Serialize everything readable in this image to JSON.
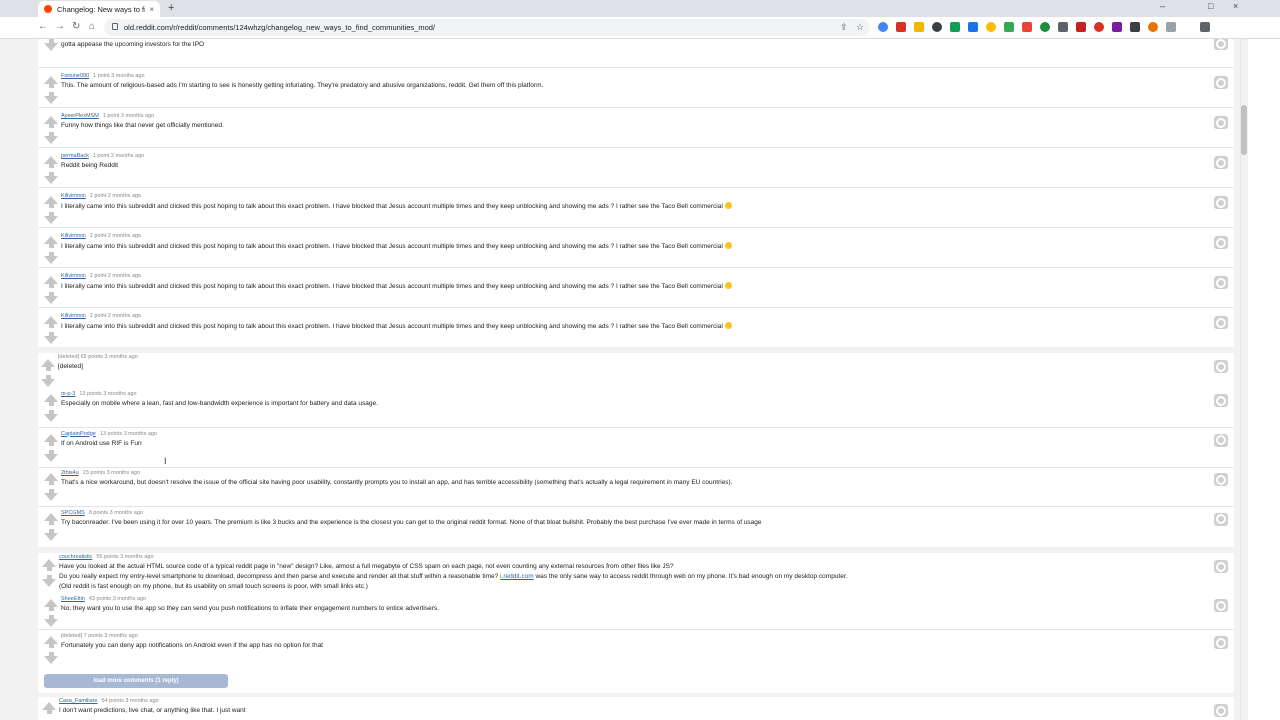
{
  "browser": {
    "tab_title": "Changelog: New ways to find c",
    "url": "old.reddit.com/r/reddit/comments/124whzg/changelog_new_ways_to_find_communities_mod/",
    "close_glyph": "×",
    "newtab_glyph": "+",
    "min_glyph": "–",
    "max_glyph": "□",
    "close_win_glyph": "×",
    "back_glyph": "←",
    "forward_glyph": "→",
    "reload_glyph": "↻",
    "home_glyph": "⌂",
    "share_glyph": "⇪",
    "star_glyph": "☆",
    "extensions_icon": "puzzle-icon",
    "extension_colors": [
      "#4285f4",
      "#d93025",
      "#f4b400",
      "#3c4043",
      "#0f9d58",
      "#1a73e8",
      "#fbbc04",
      "#34a853",
      "#ea4335",
      "#1e8e3e",
      "#5f6368",
      "#c5221f",
      "#d93025",
      "#7b1fa2",
      "#3c4043",
      "#e37400",
      "#9aa0a6"
    ]
  },
  "thread1": {
    "first_body": "gotta appease the upcoming investors for the IPO",
    "comments": [
      {
        "author": "Fortune090",
        "meta": "1 point 3 months ago",
        "body": "This. The amount of religious-based ads I'm starting to see is honestly getting infuriating. They're predatory and abusive organizations, reddit. Get them off this platform."
      },
      {
        "author": "AyeerPlexMSM",
        "meta": "1 point 3 months ago",
        "body": "Funny how things like that never get officially mentioned."
      },
      {
        "author": "permaBack",
        "meta": "1 point 2 months ago",
        "body": "Reddit being Reddit"
      },
      {
        "author": "Killvimmin",
        "meta": "1 point 2 months ago",
        "body": "I literally came into this subreddit and clicked this post hoping to talk about this exact problem. I have blocked that Jesus account multiple times and they keep unblocking and showing me ads ? I rather see the Taco Bell commercial"
      },
      {
        "author": "Killvimmin",
        "meta": "1 point 2 months ago",
        "body": "I literally came into this subreddit and clicked this post hoping to talk about this exact problem. I have blocked that Jesus account multiple times and they keep unblocking and showing me ads ? I rather see the Taco Bell commercial"
      },
      {
        "author": "Killvimmin",
        "meta": "1 point 2 months ago",
        "body": "I literally came into this subreddit and clicked this post hoping to talk about this exact problem. I have blocked that Jesus account multiple times and they keep unblocking and showing me ads ? I rather see the Taco Bell commercial"
      },
      {
        "author": "Killvimmin",
        "meta": "1 point 2 months ago",
        "body": "I literally came into this subreddit and clicked this post hoping to talk about this exact problem. I have blocked that Jesus account multiple times and they keep unblocking and showing me ads ? I rather see the Taco Bell commercial"
      }
    ]
  },
  "thread2": {
    "deleted_meta": "[deleted] 65 points 3 months ago",
    "deleted_body": "[deleted]",
    "comments": [
      {
        "author": "m-p-3",
        "meta": "13 points 3 months ago",
        "body": "Especially on mobile where a lean, fast and low-bandwidth experience is important for battery and data usage."
      },
      {
        "author": "CaptainPodge",
        "meta": "13 points 3 months ago",
        "body": "If on Android use RIF is Fun"
      },
      {
        "author": "2this4u",
        "meta": "23 points 3 months ago",
        "body": "That's a nice workaround, but doesn't resolve the issue of the official site having poor usability, constantly prompts you to install an app, and has terrible accessibility (something that's actually a legal requirement in many EU countries)."
      },
      {
        "author": "SPCGMS",
        "meta": "8 points 3 months ago",
        "body": "Try baconreader. I've been using it for over 10 years. The premium is like 3 bucks and the experience is the closest you can get to the original reddit format. None of that bloat bullshit. Probably the best purchase I've ever made in terms of usage"
      }
    ]
  },
  "thread3": {
    "author": "couchrealistic",
    "meta": "55 points 3 months ago",
    "line1": "Have you looked at the actual HTML source code of a typical reddit page in \"new\" design? Like, almost a full megabyte of CSS spam on each page, not even counting any external resources from other files like JS?",
    "line2a": "Do you really expect my entry-level smartphone to download, decompress and then parse and execute and render all that stuff within a reasonable time?",
    "line2_link": "i.reddit.com",
    "line2b": "was the only sane way to access reddit through web on my phone. It's bad enough on my desktop computer.",
    "line3": "(Old reddit is fast enough on my phone, but its usability on small touch screens is poor, with small links etc.)",
    "replies": [
      {
        "author": "SheeEttin",
        "meta": "43 points 3 months ago",
        "body": "No, they want you to use the app so they can send you push notifications to inflate their engagement numbers to entice advertisers."
      },
      {
        "author": "",
        "meta": "[deleted] 7 points 3 months ago",
        "body": "Fortunately you can deny app notifications on Android even if the app has no option for that"
      }
    ],
    "load_more": "load more comments (1 reply)"
  },
  "thread4": {
    "author": "Casa_Familiare",
    "meta": "54 points 3 months ago",
    "body": "I don't want predictions, live chat, or anything like that. I just want"
  },
  "cursor_glyph": "I"
}
